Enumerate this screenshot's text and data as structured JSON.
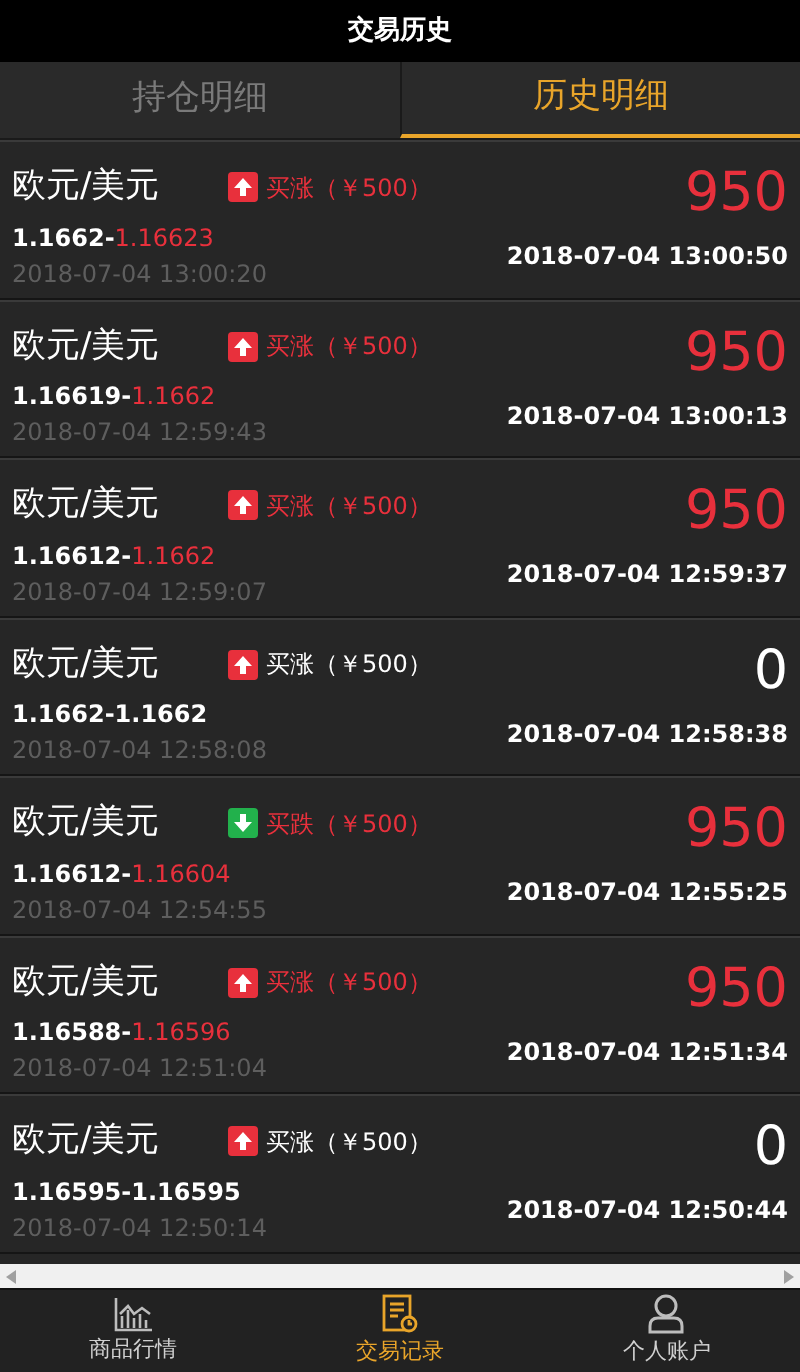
{
  "header": {
    "title": "交易历史"
  },
  "tabs": [
    {
      "label": "持仓明细",
      "selected": false
    },
    {
      "label": "历史明细",
      "selected": true
    }
  ],
  "trades": [
    {
      "pair": "欧元/美元",
      "kind": "up",
      "color": "#e8303c",
      "order": "买涨（￥500）",
      "open_price": "1.1662",
      "separator": "-",
      "close_price": "1.16623",
      "open_time": "2018-07-04 13:00:20",
      "profit": "950",
      "close_time": "2018-07-04 13:00:50"
    },
    {
      "pair": "欧元/美元",
      "kind": "up",
      "color": "#e8303c",
      "order": "买涨（￥500）",
      "open_price": "1.16619",
      "separator": "-",
      "close_price": "1.1662",
      "open_time": "2018-07-04 12:59:43",
      "profit": "950",
      "close_time": "2018-07-04 13:00:13"
    },
    {
      "pair": "欧元/美元",
      "kind": "up",
      "color": "#e8303c",
      "order": "买涨（￥500）",
      "open_price": "1.16612",
      "separator": "-",
      "close_price": "1.1662",
      "open_time": "2018-07-04 12:59:07",
      "profit": "950",
      "close_time": "2018-07-04 12:59:37"
    },
    {
      "pair": "欧元/美元",
      "kind": "up",
      "color": "#ffffff",
      "order": "买涨（￥500）",
      "open_price": "1.1662",
      "separator": "-",
      "close_price": "1.1662",
      "open_time": "2018-07-04 12:58:08",
      "profit": "0",
      "close_time": "2018-07-04 12:58:38"
    },
    {
      "pair": "欧元/美元",
      "kind": "down",
      "color": "#e8303c",
      "order": "买跌（￥500）",
      "open_price": "1.16612",
      "separator": "-",
      "close_price": "1.16604",
      "open_time": "2018-07-04 12:54:55",
      "profit": "950",
      "close_time": "2018-07-04 12:55:25"
    },
    {
      "pair": "欧元/美元",
      "kind": "up",
      "color": "#e8303c",
      "order": "买涨（￥500）",
      "open_price": "1.16588",
      "separator": "-",
      "close_price": "1.16596",
      "open_time": "2018-07-04 12:51:04",
      "profit": "950",
      "close_time": "2018-07-04 12:51:34"
    },
    {
      "pair": "欧元/美元",
      "kind": "up",
      "color": "#ffffff",
      "order": "买涨（￥500）",
      "open_price": "1.16595",
      "separator": "-",
      "close_price": "1.16595",
      "open_time": "2018-07-04 12:50:14",
      "profit": "0",
      "close_time": "2018-07-04 12:50:44"
    }
  ],
  "bottom_nav": [
    {
      "label": "商品行情",
      "selected": false
    },
    {
      "label": "交易记录",
      "selected": true
    },
    {
      "label": "个人账户",
      "selected": false
    }
  ]
}
